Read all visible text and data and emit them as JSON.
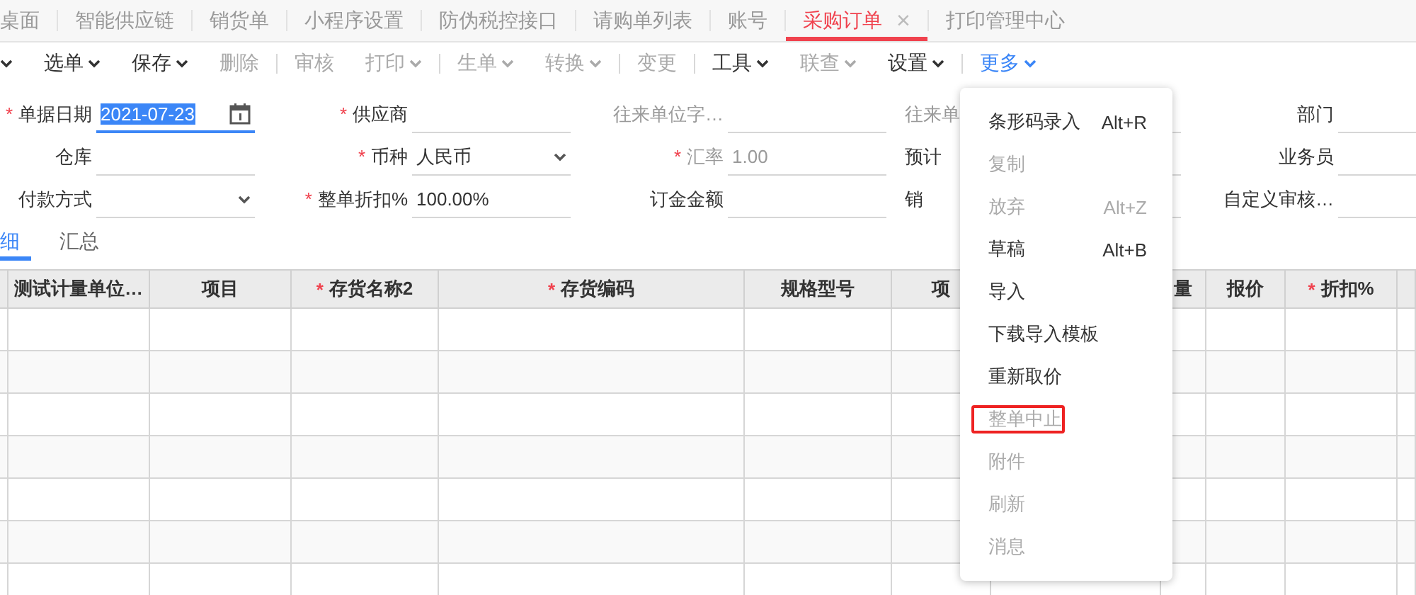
{
  "tabs": [
    {
      "label": "桌面",
      "selected": false
    },
    {
      "label": "智能供应链",
      "selected": false
    },
    {
      "label": "销货单",
      "selected": false
    },
    {
      "label": "小程序设置",
      "selected": false
    },
    {
      "label": "防伪税控接口",
      "selected": false
    },
    {
      "label": "请购单列表",
      "selected": false
    },
    {
      "label": "账号",
      "selected": false
    },
    {
      "label": "采购订单",
      "selected": true,
      "close_glyph": "×"
    },
    {
      "label": "打印管理中心",
      "selected": false
    }
  ],
  "toolbar": [
    {
      "kind": "caret"
    },
    {
      "kind": "button",
      "label": "选单",
      "dropdown": true,
      "disabled": false
    },
    {
      "kind": "button",
      "label": "保存",
      "dropdown": true,
      "disabled": false
    },
    {
      "kind": "button",
      "label": "删除",
      "dropdown": false,
      "disabled": true
    },
    {
      "kind": "separator"
    },
    {
      "kind": "button",
      "label": "审核",
      "dropdown": false,
      "disabled": true
    },
    {
      "kind": "button",
      "label": "打印",
      "dropdown": true,
      "disabled": true
    },
    {
      "kind": "separator"
    },
    {
      "kind": "button",
      "label": "生单",
      "dropdown": true,
      "disabled": true
    },
    {
      "kind": "button",
      "label": "转换",
      "dropdown": true,
      "disabled": true
    },
    {
      "kind": "separator"
    },
    {
      "kind": "button",
      "label": "变更",
      "dropdown": false,
      "disabled": true
    },
    {
      "kind": "separator"
    },
    {
      "kind": "button",
      "label": "工具",
      "dropdown": true,
      "disabled": false
    },
    {
      "kind": "button",
      "label": "联查",
      "dropdown": true,
      "disabled": true
    },
    {
      "kind": "button",
      "label": "设置",
      "dropdown": true,
      "disabled": false
    },
    {
      "kind": "separator"
    },
    {
      "kind": "button",
      "label": "更多",
      "dropdown": true,
      "disabled": false,
      "active": true
    }
  ],
  "form": {
    "rows": [
      [
        {
          "label": "单据日期",
          "required_mark": "*",
          "kind": "date",
          "value": "2021-07-23",
          "focused": true
        },
        {
          "label": "供应商",
          "required_mark": "*",
          "kind": "text"
        },
        {
          "label": "往来单位字…",
          "kind": "text",
          "disabled": true
        },
        {
          "label": "往来单",
          "kind": "text",
          "disabled": true
        },
        {
          "label": "部门",
          "kind": "text"
        }
      ],
      [
        {
          "label": "仓库",
          "kind": "text"
        },
        {
          "label": "币种",
          "required_mark": "*",
          "kind": "select",
          "value": "人民币"
        },
        {
          "label": "汇率",
          "required_mark": "*",
          "kind": "text",
          "value": "1.00",
          "disabled": true
        },
        {
          "label": "预计",
          "kind": "text"
        },
        {
          "label": "业务员",
          "kind": "text"
        }
      ],
      [
        {
          "label": "付款方式",
          "kind": "select"
        },
        {
          "label": "整单折扣%",
          "required_mark": "*",
          "kind": "text",
          "value": "100.00%"
        },
        {
          "label": "订金金额",
          "kind": "text"
        },
        {
          "label": "销",
          "kind": "text"
        },
        {
          "label": "自定义审核…",
          "kind": "text"
        }
      ]
    ]
  },
  "subtabs": [
    {
      "label": "细",
      "selected": true
    },
    {
      "label": "汇总",
      "selected": false
    }
  ],
  "table": {
    "columns": [
      {
        "label": "测试计量单位…"
      },
      {
        "label": "项目"
      },
      {
        "label": "存货名称2",
        "required_mark": "*"
      },
      {
        "label": "存货编码",
        "required_mark": "*"
      },
      {
        "label": "规格型号"
      },
      {
        "label": "项"
      },
      {
        "label": "量"
      },
      {
        "label": "报价"
      },
      {
        "label": "折扣%",
        "required_mark": "*"
      }
    ]
  },
  "more_menu": {
    "items": [
      {
        "label": "条形码录入",
        "shortcut": "Alt+R",
        "disabled": false,
        "highlighted": false
      },
      {
        "label": "复制",
        "disabled": true,
        "highlighted": false
      },
      {
        "label": "放弃",
        "shortcut": "Alt+Z",
        "disabled": true,
        "highlighted": false
      },
      {
        "label": "草稿",
        "shortcut": "Alt+B",
        "disabled": false,
        "highlighted": false
      },
      {
        "label": "导入",
        "disabled": false,
        "highlighted": false
      },
      {
        "label": "下载导入模板",
        "disabled": false,
        "highlighted": false
      },
      {
        "label": "重新取价",
        "disabled": false,
        "highlighted": false
      },
      {
        "label": "整单中止",
        "disabled": true,
        "highlighted": true
      },
      {
        "label": "附件",
        "disabled": true,
        "highlighted": false
      },
      {
        "label": "刷新",
        "disabled": true,
        "highlighted": false
      },
      {
        "label": "消息",
        "disabled": true,
        "highlighted": false
      }
    ]
  }
}
